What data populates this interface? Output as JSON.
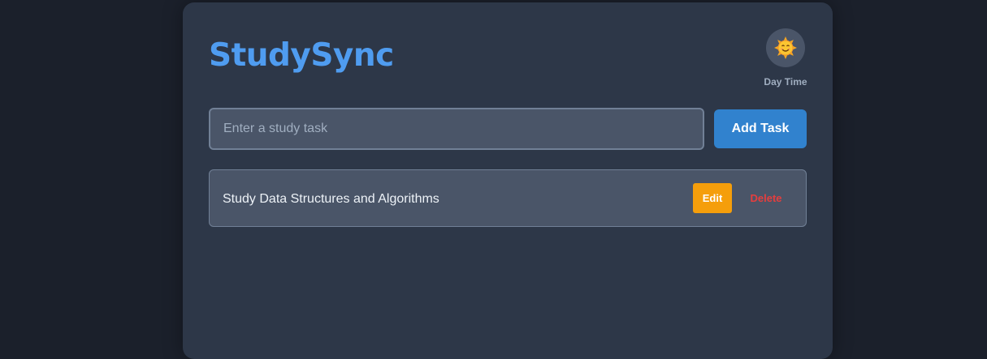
{
  "app": {
    "title": "StudySync"
  },
  "theme": {
    "icon": "sun-face-icon",
    "label": "Day Time"
  },
  "task_form": {
    "placeholder": "Enter a study task",
    "value": "",
    "add_label": "Add Task"
  },
  "tasks": [
    {
      "text": "Study Data Structures and Algorithms",
      "edit_label": "Edit",
      "delete_label": "Delete"
    }
  ],
  "colors": {
    "background": "#1b202b",
    "card": "#2d3748",
    "title": "#4f9cf0",
    "primary_button": "#3182ce",
    "edit_button": "#f59e0b",
    "delete_text": "#e53e3e"
  }
}
